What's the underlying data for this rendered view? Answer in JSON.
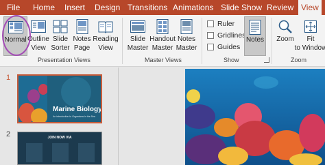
{
  "tabs": [
    {
      "label": "File",
      "active": false
    },
    {
      "label": "Home",
      "active": false
    },
    {
      "label": "Insert",
      "active": false
    },
    {
      "label": "Design",
      "active": false
    },
    {
      "label": "Transitions",
      "active": false
    },
    {
      "label": "Animations",
      "active": false
    },
    {
      "label": "Slide Show",
      "active": false
    },
    {
      "label": "Review",
      "active": false
    },
    {
      "label": "View",
      "active": true
    }
  ],
  "presentation_views": {
    "group_label": "Presentation Views",
    "normal": "Normal",
    "outline_view": "Outline View",
    "slide_sorter": "Slide Sorter",
    "notes_page": "Notes Page",
    "reading_view": "Reading View"
  },
  "master_views": {
    "group_label": "Master Views",
    "slide_master": "Slide Master",
    "handout_master": "Handout Master",
    "notes_master": "Notes Master"
  },
  "show": {
    "group_label": "Show",
    "ruler": "Ruler",
    "gridlines": "Gridlines",
    "guides": "Guides",
    "notes": "Notes"
  },
  "zoom": {
    "group_label": "Zoom",
    "zoom": "Zoom",
    "fit_to_window": "Fit to Window"
  },
  "slides": [
    {
      "number": "1",
      "title": "Marine Biology",
      "subtitle": "An introduction to Organisms in the Sea"
    },
    {
      "number": "2",
      "heading": "JOIN NOW VIA"
    }
  ],
  "colors": {
    "accent": "#b7472a",
    "highlight": "#a34bb5"
  }
}
